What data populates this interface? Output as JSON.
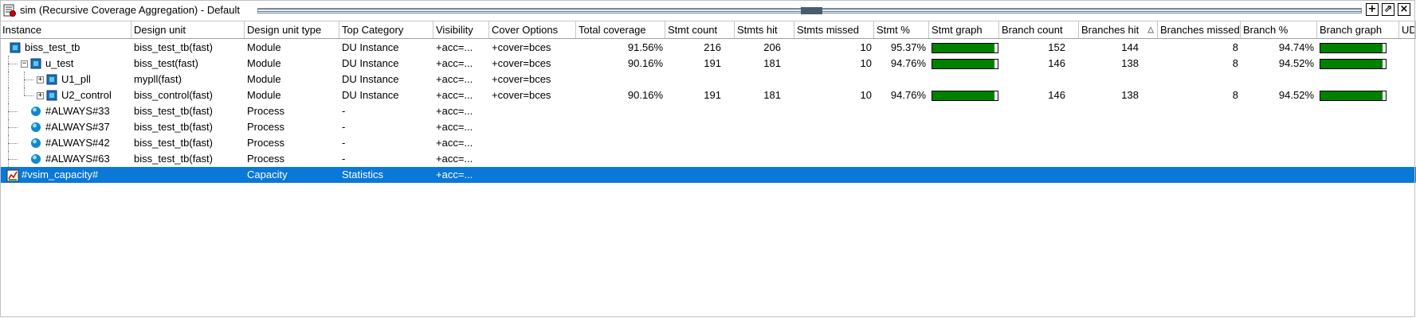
{
  "window": {
    "title": "sim (Recursive Coverage Aggregation) - Default",
    "buttons": [
      {
        "name": "add",
        "symbol": "+"
      },
      {
        "name": "undock",
        "symbol": "⇗"
      },
      {
        "name": "close",
        "symbol": "×"
      }
    ]
  },
  "columns": [
    "Instance",
    "Design unit",
    "Design unit type",
    "Top Category",
    "Visibility",
    "Cover Options",
    "Total coverage",
    "Stmt count",
    "Stmts hit",
    "Stmts missed",
    "Stmt %",
    "Stmt graph",
    "Branch count",
    "Branches hit",
    "Branches missed",
    "Branch %",
    "Branch graph",
    "UD"
  ],
  "sort_indicator": "△",
  "colors": {
    "selection": "#0a78d7",
    "bar_fill": "#008000"
  },
  "rows": [
    {
      "instance": "biss_test_tb",
      "design_unit": "biss_test_tb(fast)",
      "type": "Module",
      "top_category": "DU Instance",
      "visibility": "+acc=...",
      "cover_options": "+cover=bces",
      "total_coverage": "91.56%",
      "stmt_count": "216",
      "stmts_hit": "206",
      "stmts_missed": "10",
      "stmt_pct": "95.37%",
      "stmt_graph": 0.9537,
      "branch_count": "152",
      "branches_hit": "144",
      "branches_missed": "8",
      "branch_pct": "94.74%",
      "branch_graph": 0.9474,
      "icon": "module-icon"
    },
    {
      "instance": "u_test",
      "design_unit": "biss_test(fast)",
      "type": "Module",
      "top_category": "DU Instance",
      "visibility": "+acc=...",
      "cover_options": "+cover=bces",
      "total_coverage": "90.16%",
      "stmt_count": "191",
      "stmts_hit": "181",
      "stmts_missed": "10",
      "stmt_pct": "94.76%",
      "stmt_graph": 0.9476,
      "branch_count": "146",
      "branches_hit": "138",
      "branches_missed": "8",
      "branch_pct": "94.52%",
      "branch_graph": 0.9452,
      "icon": "module-icon"
    },
    {
      "instance": "U1_pll",
      "design_unit": "mypll(fast)",
      "type": "Module",
      "top_category": "DU Instance",
      "visibility": "+acc=...",
      "cover_options": "+cover=bces",
      "icon": "module-icon"
    },
    {
      "instance": "U2_control",
      "design_unit": "biss_control(fast)",
      "type": "Module",
      "top_category": "DU Instance",
      "visibility": "+acc=...",
      "cover_options": "+cover=bces",
      "total_coverage": "90.16%",
      "stmt_count": "191",
      "stmts_hit": "181",
      "stmts_missed": "10",
      "stmt_pct": "94.76%",
      "stmt_graph": 0.9476,
      "branch_count": "146",
      "branches_hit": "138",
      "branches_missed": "8",
      "branch_pct": "94.52%",
      "branch_graph": 0.9452,
      "icon": "module-icon"
    },
    {
      "instance": "#ALWAYS#33",
      "design_unit": "biss_test_tb(fast)",
      "type": "Process",
      "top_category": "-",
      "visibility": "+acc=...",
      "icon": "process-icon"
    },
    {
      "instance": "#ALWAYS#37",
      "design_unit": "biss_test_tb(fast)",
      "type": "Process",
      "top_category": "-",
      "visibility": "+acc=...",
      "icon": "process-icon"
    },
    {
      "instance": "#ALWAYS#42",
      "design_unit": "biss_test_tb(fast)",
      "type": "Process",
      "top_category": "-",
      "visibility": "+acc=...",
      "icon": "process-icon"
    },
    {
      "instance": "#ALWAYS#63",
      "design_unit": "biss_test_tb(fast)",
      "type": "Process",
      "top_category": "-",
      "visibility": "+acc=...",
      "icon": "process-icon"
    },
    {
      "instance": "#vsim_capacity#",
      "design_unit": "",
      "type": "Capacity",
      "top_category": "Statistics",
      "visibility": "+acc=...",
      "icon": "capacity-icon",
      "selected": true
    }
  ]
}
